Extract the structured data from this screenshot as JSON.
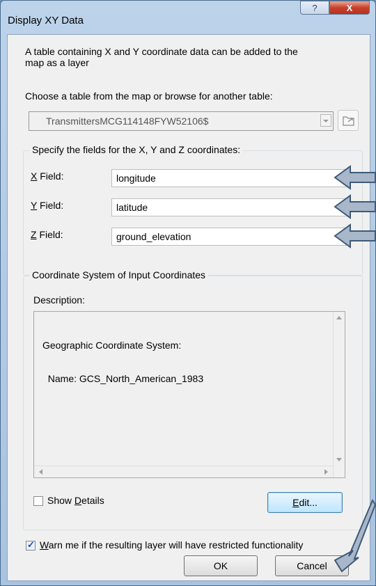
{
  "window": {
    "title": "Display XY Data",
    "help_glyph": "?",
    "close_glyph": "X"
  },
  "intro_text_line1": "A table containing X and Y coordinate data can be added to the",
  "intro_text_line2": "map as a layer",
  "choose_table_label": "Choose a table from the map or browse for another table:",
  "table_combo_value": "TransmittersMCG114148FYW52106$",
  "fields_group": {
    "legend": "Specify the fields for the X, Y and Z coordinates:",
    "x": {
      "label_accel": "X",
      "label_rest": " Field:",
      "value": "longitude"
    },
    "y": {
      "label_accel": "Y",
      "label_rest": " Field:",
      "value": "latitude"
    },
    "z": {
      "label_accel": "Z",
      "label_rest": " Field:",
      "value": "ground_elevation"
    }
  },
  "coord_group": {
    "legend": "Coordinate System of Input Coordinates",
    "description_label": "Description:",
    "description_line1": "Geographic Coordinate System:",
    "description_line2": "  Name: GCS_North_American_1983",
    "show_details_pre": "Show ",
    "show_details_accel": "D",
    "show_details_post": "etails",
    "show_details_checked": false,
    "edit_accel": "E",
    "edit_rest": "dit..."
  },
  "warn": {
    "checked": true,
    "label_accel": "W",
    "label_rest": "arn me if the resulting layer will have restricted functionality"
  },
  "buttons": {
    "ok": "OK",
    "cancel": "Cancel"
  },
  "colors": {
    "annotation_arrow_fill": "#a8b7c9",
    "annotation_arrow_stroke": "#3e5a78"
  }
}
